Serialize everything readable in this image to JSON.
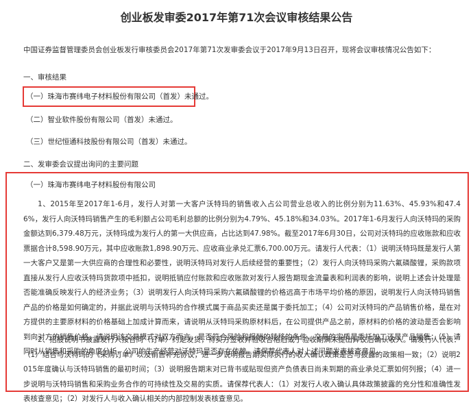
{
  "title": "创业板发审委2017年第71次会议审核结果公告",
  "intro": "中国证券监督管理委员会创业板发行审核委员会2017年第71次发审委会议于2017年9月13日召开，现将会议审核情况公告如下：",
  "section1": {
    "heading": "一、审核结果",
    "items": [
      "（一）珠海市赛纬电子材料股份有限公司（首发）未通过。",
      "（二）智业软件股份有限公司（首发）未通过。",
      "（三）世纪恒通科技股份有限公司（首发）未通过。"
    ]
  },
  "section2": {
    "heading": "二、发审委会议提出询问的主要问题",
    "company": "（一）珠海市赛纬电子材料股份有限公司",
    "q1": "1、2015年至2017年1-6月，发行人对第一大客户沃特玛的销售收入占公司营业总收入的比例分别为11.63%、45.93%和47.46%，发行人向沃特玛销售产生的毛利额占公司毛利总额的比例分别为4.79%、45.18%和34.03%。2017年1-6月发行人向沃特玛的采购金额达到6,379.48万元，沃特玛成为发行人的第一大供应商，占比达到47.98%。截至2017年6月30日，公司对沃特玛的应收账款和应收票据合计8,598.90万元，其中应收账款1,898.90万元、应收商业承兑汇票6,700.00万元。请发行人代表：（1）说明沃特玛既是发行人第一大客户又是第一大供应商的合理性和必要性，说明沃特玛对发行人后续经营的重要性；（2）发行人向沃特玛采购六氟磷酸锂，采购款项直接从发行人应收沃特玛货款项中抵扣，说明抵销应付账款和应收账款对发行人报告期现金流量表和利润表的影响，说明上述会计处理是否能准确反映发行人的经济业务；（3）说明发行人向沃特玛采购六氟磷酸锂的价格远高于市场平均价格的原因，说明发行人向沃特玛销售产品的价格是如何确定的，并据此说明与沃特玛的合作模式属于商品买卖还是属于委托加工；（4）公司对沃特玛的产品销售价格，是在对方提供的主要原材料的价格基础上加成计算而来，请说明从沃特玛采购原材料后，在公司提供产品之前，原材料的价格的波动是否会影响到向对方的销售价格，请说明该交易模式对双方而言，是否符合风险和报酬的转移的条件，交易的实质是委托加工还是产品销售；（5）请同时从销售和采购的角度分析，公司的生产经营对沃特玛是否存在依赖。请保荐代表人对上述问题发表核查意见。",
    "q2": "2、招股说明书披露发行人按合同（订单）约定发货，待买方签收并验收合格后或于验收期满未提出异议后确认收入。请发行人代表：（1）结合与沃特玛的《采购订单》以及销售补充协议，进一步说明报告期实际执行的收入确认政策是否与披露的政策相一致；（2）说明2015年度确认与沃特玛销售的最初时间；（3）说明报告期末对已背书或贴现但资产负债表日尚未到期的商业承兑汇票如何列报；（4）进一步说明与沃特玛销售和采购业务合作的可持续性及交易的实质。请保荐代表人：（1）对发行人收入确认具体政策披露的充分性和准确性发表核查意见；（2）对发行人与收入确认相关的内部控制发表核查意见。"
  },
  "colors": {
    "highlight_border": "#e53935",
    "text": "#333333"
  }
}
